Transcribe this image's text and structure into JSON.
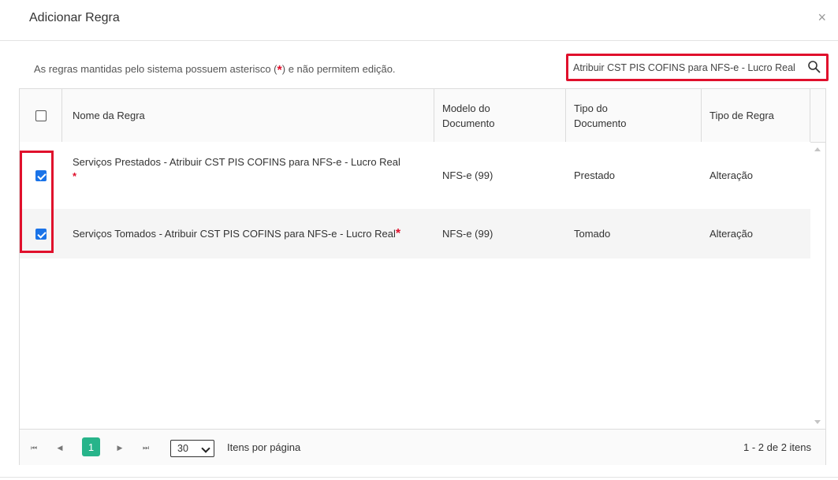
{
  "dialog": {
    "title": "Adicionar Regra",
    "close_glyph": "×"
  },
  "note": {
    "before": "As regras mantidas pelo sistema possuem asterisco (",
    "asterisk": "*",
    "after": ") e não permitem edição."
  },
  "search": {
    "value": "Atribuir CST PIS COFINS para NFS-e - Lucro Real",
    "icon": "search-icon"
  },
  "table": {
    "headers": {
      "name": "Nome da Regra",
      "model": "Modelo do Documento",
      "doc_type": "Tipo do Documento",
      "rule_type": "Tipo de Regra"
    },
    "rows": [
      {
        "checked": true,
        "name": "Serviços Prestados - Atribuir CST PIS COFINS para NFS-e - Lucro Real",
        "asterisk": "*",
        "model": "NFS-e (99)",
        "doc_type": "Prestado",
        "rule_type": "Alteração"
      },
      {
        "checked": true,
        "name": "Serviços Tomados - Atribuir CST PIS COFINS para NFS-e - Lucro Real",
        "asterisk": "*",
        "model": "NFS-e (99)",
        "doc_type": "Tomado",
        "rule_type": "Alteração"
      }
    ]
  },
  "pager": {
    "first": "⏮",
    "prev": "◀",
    "current_page": "1",
    "next": "▶",
    "last": "⏭",
    "page_size": "30",
    "per_page_label": "Itens por página",
    "count": "1 - 2 de 2 itens"
  },
  "colors": {
    "highlight": "#e0102c",
    "checkbox": "#1a73e8",
    "page_active": "#27b48a"
  }
}
